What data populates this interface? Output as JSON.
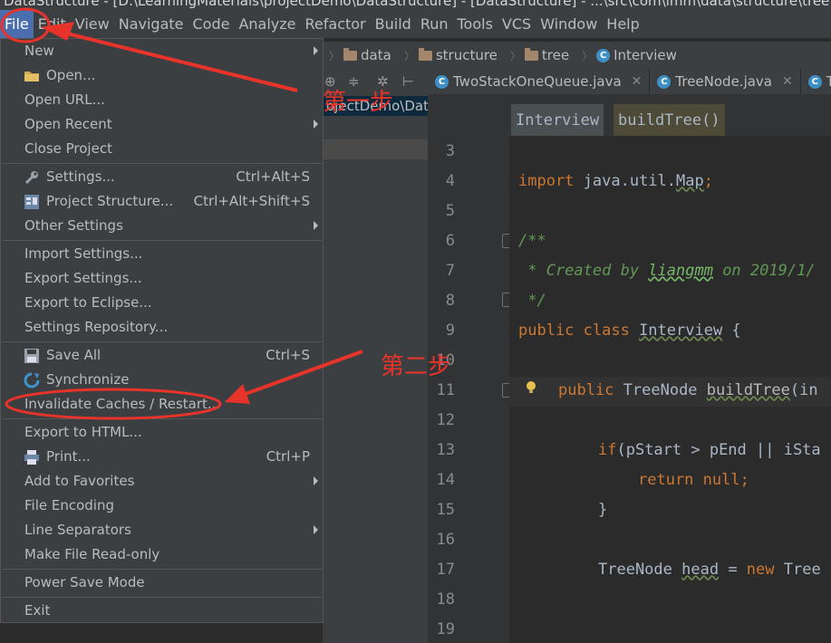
{
  "window": {
    "title": "DataStructure - [D:\\LearningMaterials\\projectDemo\\DataStructure] - [DataStructure] - ...\\src\\com\\lmm\\data\\structure\\tree"
  },
  "menubar": {
    "items": [
      "File",
      "Edit",
      "View",
      "Navigate",
      "Code",
      "Analyze",
      "Refactor",
      "Build",
      "Run",
      "Tools",
      "VCS",
      "Window",
      "Help"
    ]
  },
  "navbar": {
    "crumbs": [
      "data",
      "structure",
      "tree",
      "Interview"
    ]
  },
  "project_panel": {
    "row_text": "ojectDemo\\Dat"
  },
  "tabs": [
    "TwoStackOneQueue.java",
    "TreeNode.java",
    "T"
  ],
  "code_breadcrumbs": [
    "Interview",
    "buildTree()"
  ],
  "editor": {
    "line_numbers": [
      "3",
      "4",
      "5",
      "6",
      "7",
      "8",
      "9",
      "10",
      "11",
      "12",
      "13",
      "14",
      "15",
      "16",
      "17",
      "18",
      "19"
    ],
    "lines": {
      "l4_kw": "import",
      "l4_a": " java.util.",
      "l4_b": "Map",
      "l4_c": ";",
      "l6": "/**",
      "l7_a": " * Created by ",
      "l7_b": "liangmm",
      "l7_c": " on 2019/1/",
      "l8": " */",
      "l9_kw": "public class ",
      "l9_b": "Interview",
      "l9_c": " {",
      "l11_kw": "public ",
      "l11_b": "TreeNode ",
      "l11_c": "buildTree",
      "l11_d": "(in",
      "l13_kw": "if",
      "l13_b": "(pStart > pEnd || iSta",
      "l14_kw": "return null",
      "l14_b": ";",
      "l15": "}",
      "l17_a": "TreeNode ",
      "l17_b": "head",
      "l17_c": " = ",
      "l17_kw": "new",
      "l17_d": " Tree"
    }
  },
  "file_menu": {
    "items": [
      {
        "label": "New",
        "shortcut": "",
        "submenu": true
      },
      {
        "label": "Open...",
        "shortcut": "",
        "icon": "folder-icon"
      },
      {
        "label": "Open URL...",
        "shortcut": ""
      },
      {
        "label": "Open Recent",
        "shortcut": "",
        "submenu": true
      },
      {
        "label": "Close Project",
        "shortcut": ""
      },
      {
        "label": "Settings...",
        "shortcut": "Ctrl+Alt+S",
        "icon": "wrench-icon"
      },
      {
        "label": "Project Structure...",
        "shortcut": "Ctrl+Alt+Shift+S",
        "icon": "project-structure-icon"
      },
      {
        "label": "Other Settings",
        "shortcut": "",
        "submenu": true
      },
      {
        "label": "Import Settings...",
        "shortcut": ""
      },
      {
        "label": "Export Settings...",
        "shortcut": ""
      },
      {
        "label": "Export to Eclipse...",
        "shortcut": ""
      },
      {
        "label": "Settings Repository...",
        "shortcut": ""
      },
      {
        "label": "Save All",
        "shortcut": "Ctrl+S",
        "icon": "save-icon"
      },
      {
        "label": "Synchronize",
        "shortcut": "",
        "icon": "sync-icon"
      },
      {
        "label": "Invalidate Caches / Restart...",
        "shortcut": ""
      },
      {
        "label": "Export to HTML...",
        "shortcut": ""
      },
      {
        "label": "Print...",
        "shortcut": "Ctrl+P",
        "icon": "print-icon"
      },
      {
        "label": "Add to Favorites",
        "shortcut": "",
        "submenu": true
      },
      {
        "label": "File Encoding",
        "shortcut": ""
      },
      {
        "label": "Line Separators",
        "shortcut": "",
        "submenu": true
      },
      {
        "label": "Make File Read-only",
        "shortcut": ""
      },
      {
        "label": "Power Save Mode",
        "shortcut": ""
      },
      {
        "label": "Exit",
        "shortcut": ""
      }
    ]
  },
  "annotations": {
    "step1": "第一步",
    "step2": "第二步"
  },
  "colors": {
    "annotation": "#e8332a",
    "menu_active": "#4b6eaf",
    "menu_bg": "#3c3f41",
    "editor_bg": "#2b2b2b"
  }
}
